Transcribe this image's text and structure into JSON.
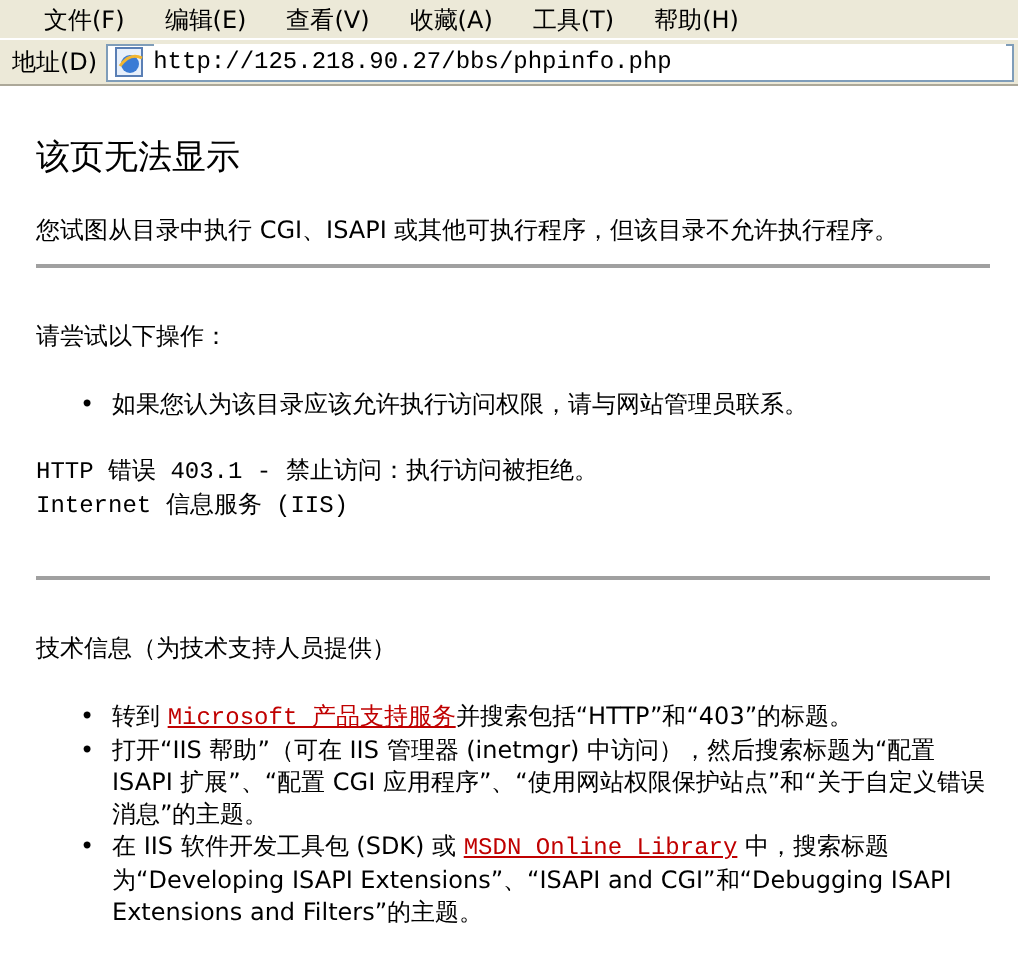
{
  "menu_bar": [
    {
      "label": "文件(F)"
    },
    {
      "label": "编辑(E)"
    },
    {
      "label": "查看(V)"
    },
    {
      "label": "收藏(A)"
    },
    {
      "label": "工具(T)"
    },
    {
      "label": "帮助(H)"
    }
  ],
  "address_bar": {
    "label": "地址(D)",
    "url": "http://125.218.90.27/bbs/phpinfo.php"
  },
  "page": {
    "title": "该页无法显示",
    "description": "您试图从目录中执行 CGI、ISAPI 或其他可执行程序，但该目录不允许执行程序。",
    "try_heading": "请尝试以下操作：",
    "try_items": [
      {
        "bullet": "•",
        "text": "如果您认为该目录应该允许执行访问权限，请与网站管理员联系。"
      }
    ],
    "error_lines": [
      "HTTP 错误 403.1 - 禁止访问：执行访问被拒绝。",
      "Internet 信息服务 (IIS)"
    ],
    "tech_heading": "技术信息（为技术支持人员提供）",
    "tech_items": [
      {
        "bullet": "•",
        "before": "转到 ",
        "link": "Microsoft 产品支持服务",
        "after": "并搜索包括“HTTP”和“403”的标题。"
      },
      {
        "bullet": "•",
        "before": "打开“IIS 帮助”（可在 IIS 管理器 (inetmgr) 中访问），然后搜索标题为“配置 ISAPI 扩展”、“配置 CGI 应用程序”、“使用网站权限保护站点”和“关于自定义错误消息”的主题。"
      },
      {
        "bullet": "•",
        "before": "在 IIS 软件开发工具包 (SDK) 或 ",
        "link": "MSDN Online Library",
        "after": " 中，搜索标题为“Developing ISAPI Extensions”、“ISAPI and CGI”和“Debugging ISAPI Extensions and Filters”的主题。"
      }
    ]
  }
}
